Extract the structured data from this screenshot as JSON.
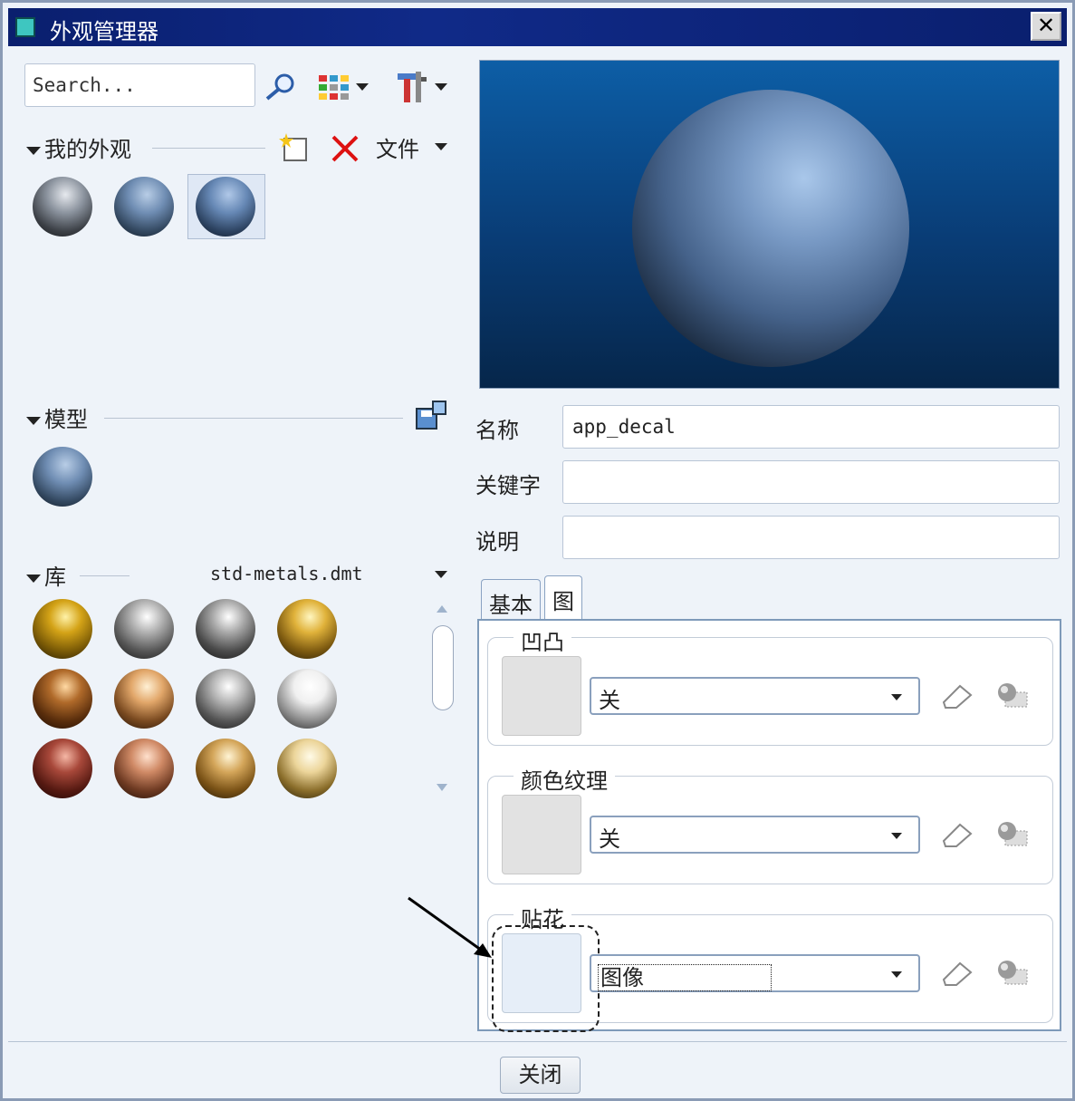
{
  "window": {
    "title": "外观管理器",
    "close_glyph": "✕"
  },
  "search": {
    "value": "Search..."
  },
  "my_appearances": {
    "label": "我的外观",
    "file_menu": "文件"
  },
  "model": {
    "label": "模型"
  },
  "library": {
    "label": "库",
    "file": "std-metals.dmt"
  },
  "properties": {
    "name_label": "名称",
    "name_value": "app_decal",
    "keyword_label": "关键字",
    "keyword_value": "",
    "description_label": "说明",
    "description_value": ""
  },
  "tabs": [
    {
      "label": "基本"
    },
    {
      "label": "图",
      "active": true
    }
  ],
  "maps": {
    "bump": {
      "label": "凹凸",
      "value": "关"
    },
    "color_texture": {
      "label": "颜色纹理",
      "value": "关"
    },
    "decal": {
      "label": "贴花",
      "value": "图像"
    }
  },
  "footer": {
    "close_label": "关闭"
  },
  "colors": {
    "title_bar": "#0a1f6e",
    "preview_bg": "#093c75",
    "sphere_blue": "#7899c4"
  }
}
